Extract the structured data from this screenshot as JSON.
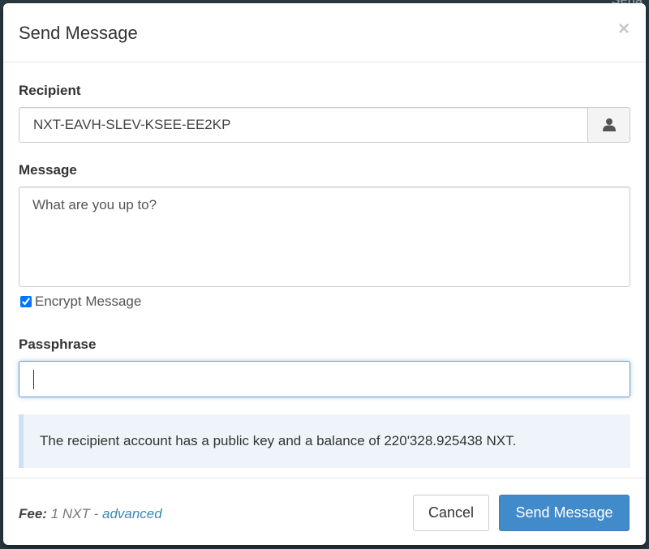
{
  "backdrop": {
    "corner_text": "Sena"
  },
  "modal": {
    "title": "Send Message",
    "close_glyph": "×"
  },
  "recipient": {
    "label": "Recipient",
    "value": "NXT-EAVH-SLEV-KSEE-EE2KP",
    "addon_icon": "user-icon"
  },
  "message": {
    "label": "Message",
    "placeholder": "What are you up to?",
    "encrypt_label": "Encrypt Message",
    "encrypt_checked": true
  },
  "passphrase": {
    "label": "Passphrase",
    "value": ""
  },
  "alert": {
    "text": "The recipient account has a public key and a balance of 220'328.925438 NXT."
  },
  "footer": {
    "fee_label": "Fee:",
    "fee_value": " 1 NXT - ",
    "advanced_link": "advanced",
    "cancel_label": "Cancel",
    "submit_label": "Send Message"
  },
  "colors": {
    "primary": "#428bca",
    "link": "#3a87b8",
    "alert_bg": "#eef4fa"
  }
}
